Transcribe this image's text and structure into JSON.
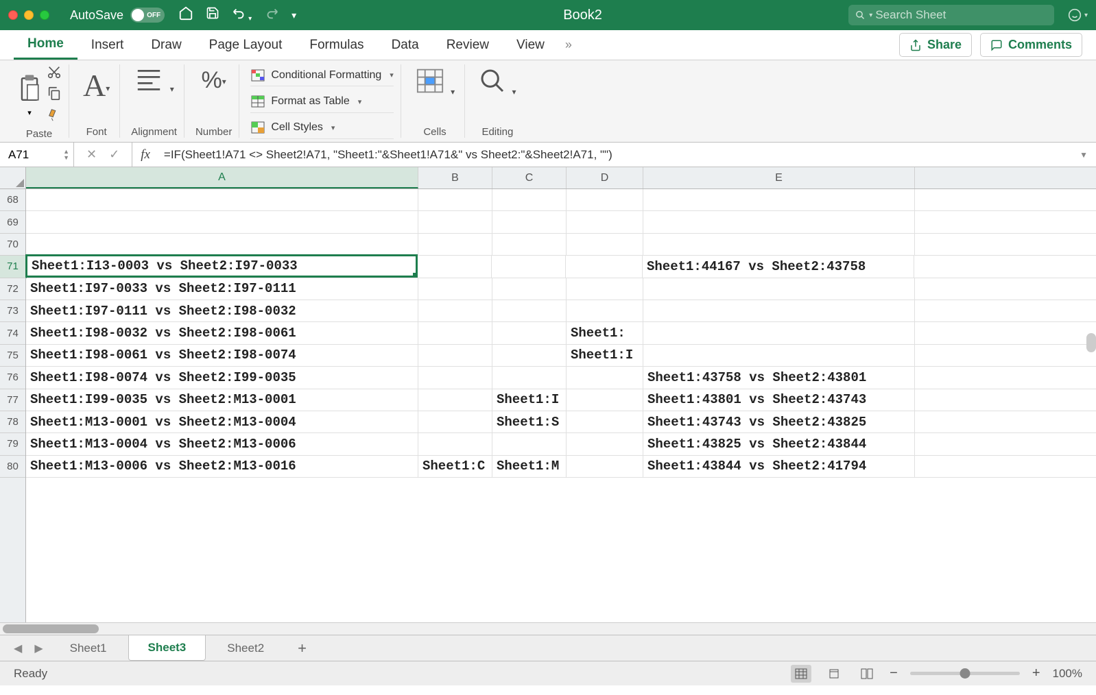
{
  "titlebar": {
    "autosave_label": "AutoSave",
    "autosave_state": "OFF",
    "title": "Book2",
    "search_placeholder": "Search Sheet"
  },
  "ribbon_tabs": {
    "home": "Home",
    "insert": "Insert",
    "draw": "Draw",
    "page_layout": "Page Layout",
    "formulas": "Formulas",
    "data": "Data",
    "review": "Review",
    "view": "View",
    "share": "Share",
    "comments": "Comments"
  },
  "ribbon_groups": {
    "paste": "Paste",
    "font": "Font",
    "alignment": "Alignment",
    "number": "Number",
    "cond_fmt": "Conditional Formatting",
    "format_table": "Format as Table",
    "cell_styles": "Cell Styles",
    "cells": "Cells",
    "editing": "Editing"
  },
  "formula_bar": {
    "name_box": "A71",
    "formula": "=IF(Sheet1!A71 <> Sheet2!A71, \"Sheet1:\"&Sheet1!A71&\" vs Sheet2:\"&Sheet2!A71, \"\")"
  },
  "columns": [
    "A",
    "B",
    "C",
    "D",
    "E"
  ],
  "row_numbers": [
    68,
    69,
    70,
    71,
    72,
    73,
    74,
    75,
    76,
    77,
    78,
    79,
    80
  ],
  "selected_cell": "A71",
  "selected_row": 71,
  "selected_col": "A",
  "cell_data": {
    "68": {
      "A": "",
      "B": "",
      "C": "",
      "D": "",
      "E": ""
    },
    "69": {
      "A": "",
      "B": "",
      "C": "",
      "D": "",
      "E": ""
    },
    "70": {
      "A": "",
      "B": "",
      "C": "",
      "D": "",
      "E": ""
    },
    "71": {
      "A": "Sheet1:I13-0003 vs Sheet2:I97-0033",
      "B": "",
      "C": "",
      "D": "",
      "E": "Sheet1:44167 vs Sheet2:43758"
    },
    "72": {
      "A": "Sheet1:I97-0033 vs Sheet2:I97-0111",
      "B": "",
      "C": "",
      "D": "",
      "E": ""
    },
    "73": {
      "A": "Sheet1:I97-0111 vs Sheet2:I98-0032",
      "B": "",
      "C": "",
      "D": "",
      "E": ""
    },
    "74": {
      "A": "Sheet1:I98-0032 vs Sheet2:I98-0061",
      "B": "",
      "C": "",
      "D": "Sheet1:",
      "E": ""
    },
    "75": {
      "A": "Sheet1:I98-0061 vs Sheet2:I98-0074",
      "B": "",
      "C": "",
      "D": "Sheet1:I",
      "E": ""
    },
    "76": {
      "A": "Sheet1:I98-0074 vs Sheet2:I99-0035",
      "B": "",
      "C": "",
      "D": "",
      "E": "Sheet1:43758 vs Sheet2:43801"
    },
    "77": {
      "A": "Sheet1:I99-0035 vs Sheet2:M13-0001",
      "B": "",
      "C": "Sheet1:I",
      "D": "",
      "E": "Sheet1:43801 vs Sheet2:43743"
    },
    "78": {
      "A": "Sheet1:M13-0001 vs Sheet2:M13-0004",
      "B": "",
      "C": "Sheet1:S",
      "D": "",
      "E": "Sheet1:43743 vs Sheet2:43825"
    },
    "79": {
      "A": "Sheet1:M13-0004 vs Sheet2:M13-0006",
      "B": "",
      "C": "",
      "D": "",
      "E": "Sheet1:43825 vs Sheet2:43844"
    },
    "80": {
      "A": "Sheet1:M13-0006 vs Sheet2:M13-0016",
      "B": "Sheet1:C",
      "C": "Sheet1:M",
      "D": "",
      "E": "Sheet1:43844 vs Sheet2:41794"
    }
  },
  "sheets": {
    "sheet1": "Sheet1",
    "sheet3": "Sheet3",
    "sheet2": "Sheet2",
    "active": "Sheet3"
  },
  "status": {
    "ready": "Ready",
    "zoom": "100%"
  }
}
